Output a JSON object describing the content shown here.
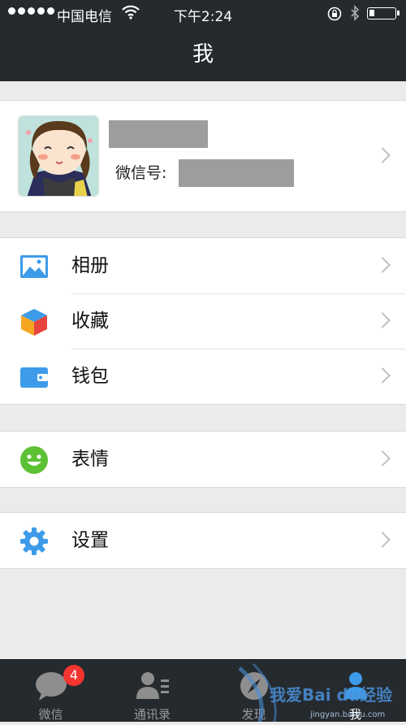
{
  "status_bar": {
    "carrier": "中国电信",
    "time": "下午2:24",
    "icons": [
      "signal-dots-icon",
      "wifi-icon",
      "rotation-lock-icon",
      "bluetooth-icon",
      "battery-icon"
    ]
  },
  "nav": {
    "title": "我"
  },
  "profile": {
    "name_redacted": true,
    "wechat_id_label": "微信号:",
    "wechat_id_redacted": true
  },
  "menu": {
    "section1": [
      {
        "label": "相册",
        "icon": "photo-album-icon",
        "color": "#3d9be9"
      },
      {
        "label": "收藏",
        "icon": "favorites-cube-icon",
        "color": "#f5a623"
      },
      {
        "label": "钱包",
        "icon": "wallet-icon",
        "color": "#3d9be9"
      }
    ],
    "section2": [
      {
        "label": "表情",
        "icon": "smiley-icon",
        "color": "#5cc134"
      }
    ],
    "section3": [
      {
        "label": "设置",
        "icon": "gear-icon",
        "color": "#3d9be9"
      }
    ]
  },
  "tab_bar": {
    "tabs": [
      {
        "label": "微信",
        "icon": "chat-bubble-icon",
        "badge": "4"
      },
      {
        "label": "通讯录",
        "icon": "contacts-icon"
      },
      {
        "label": "发现",
        "icon": "compass-icon"
      },
      {
        "label": "我",
        "icon": "person-icon",
        "active": true
      }
    ]
  },
  "watermark": {
    "text": "我爱Bai du经验",
    "url": "jingyan.baidu.com"
  },
  "colors": {
    "bar_background": "#252a2e",
    "page_background": "#ebebeb",
    "badge": "#f43530"
  }
}
